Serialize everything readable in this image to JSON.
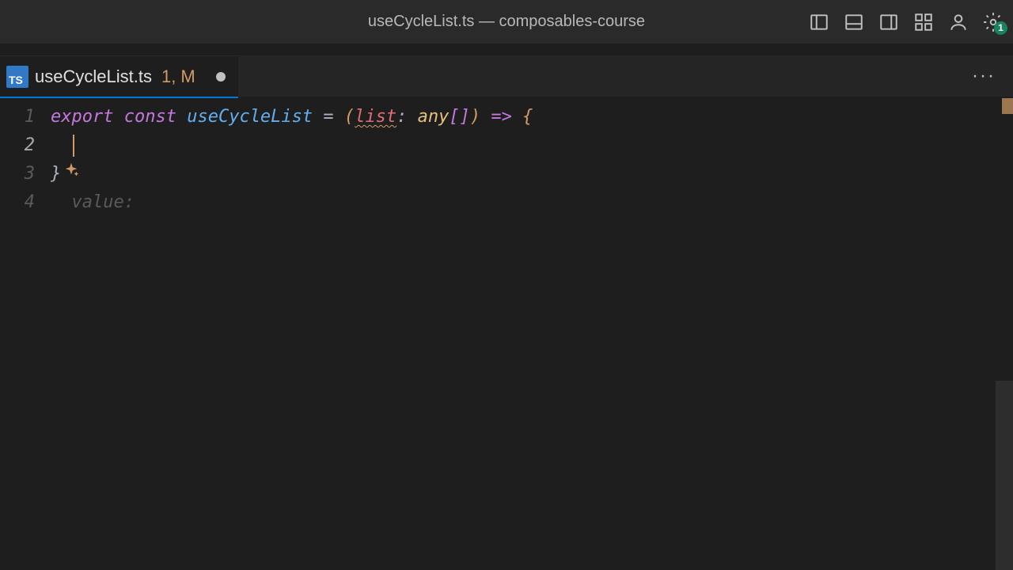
{
  "title": "useCycleList.ts — composables-course",
  "settings_badge": "1",
  "tab": {
    "icon_label": "TS",
    "filename": "useCycleList.ts",
    "status": "1, M"
  },
  "gutter": {
    "lines": [
      "1",
      "2",
      "3",
      "4"
    ]
  },
  "code": {
    "l1": {
      "export": "export",
      "const": "const",
      "name": "useCycleList",
      "eq": " = ",
      "lparen": "(",
      "param": "list",
      "colon": ": ",
      "type": "any",
      "sqopen": "[",
      "sqclose": "]",
      "rparen": ")",
      "arrow": " => ",
      "brace_open": "{"
    },
    "l3": {
      "brace_close": "}"
    },
    "l4": {
      "ghost": "  value:"
    }
  }
}
